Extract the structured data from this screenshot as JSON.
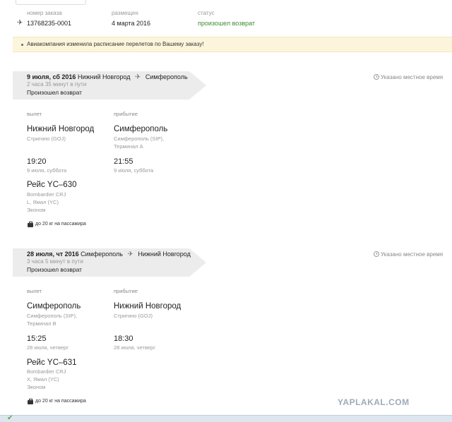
{
  "order": {
    "number_label": "номер заказа",
    "number_value": "13768235-0001",
    "placed_label": "размещен",
    "placed_value": "4 марта 2016",
    "status_label": "статус",
    "status_value": "произошел возврат"
  },
  "notice": "Авиакомпания изменила расписание перелетов по Вашему заказу!",
  "segments": [
    {
      "date": "9 июля, сб 2016",
      "from": "Нижний Новгород",
      "to": "Симферополь",
      "duration": "2 часа 35 минут в пути",
      "status": "Произошел возврат",
      "local_time_note": "Указано местное время",
      "dep_label": "вылет",
      "arr_label": "прибытие",
      "dep_city": "Нижний Новгород",
      "dep_airport": "Стригино (GOJ)",
      "dep_terminal": "",
      "arr_city": "Симферополь",
      "arr_airport": "Симферополь (SIP),",
      "arr_terminal": "Терминал A",
      "dep_time": "19:20",
      "dep_date": "9 июля, суббота",
      "arr_time": "21:55",
      "arr_date": "9 июля, суббота",
      "flight": "Рейс YC–630",
      "aircraft": "Bombardier CRJ",
      "fare": "L, Ямал (YC)",
      "cabin": "Эконом",
      "baggage": "до 20 кг на пассажира"
    },
    {
      "date": "28 июля, чт 2016",
      "from": "Симферополь",
      "to": "Нижний Новгород",
      "duration": "3 часа 5 минут в пути",
      "status": "Произошел возврат",
      "local_time_note": "Указано местное время",
      "dep_label": "вылет",
      "arr_label": "прибытие",
      "dep_city": "Симферополь",
      "dep_airport": "Симферополь (SIP),",
      "dep_terminal": "Терминал B",
      "arr_city": "Нижний Новгород",
      "arr_airport": "Стригино (GOJ)",
      "arr_terminal": "",
      "dep_time": "15:25",
      "dep_date": "28 июля, четверг",
      "arr_time": "18:30",
      "arr_date": "28 июля, четверг",
      "flight": "Рейс YC–631",
      "aircraft": "Bombardier CRJ",
      "fare": "X, Ямал (YC)",
      "cabin": "Эконом",
      "baggage": "до 20 кг на пассажира"
    }
  ],
  "watermark": "YAPLAKAL.COM",
  "colors": {
    "status_green": "#3d8b2f",
    "notice_bg": "#fcf5dc",
    "header_bg": "#ececec"
  }
}
